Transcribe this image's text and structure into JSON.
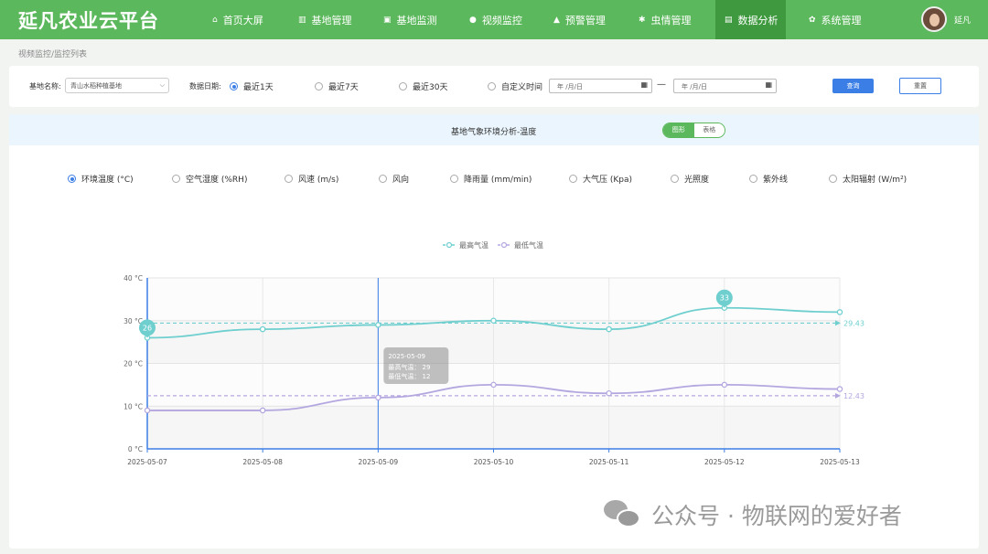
{
  "app": {
    "title": "延凡农业云平台",
    "username": "延凡"
  },
  "nav": [
    {
      "label": "首页大屏",
      "icon": "home-icon",
      "glyph": "⌂"
    },
    {
      "label": "基地管理",
      "icon": "map-icon",
      "glyph": "▥"
    },
    {
      "label": "基地监测",
      "icon": "monitor-icon",
      "glyph": "▣"
    },
    {
      "label": "视频监控",
      "icon": "location-pin-icon",
      "glyph": "●"
    },
    {
      "label": "预警管理",
      "icon": "alarm-icon",
      "glyph": "▲"
    },
    {
      "label": "虫情管理",
      "icon": "bug-icon",
      "glyph": "✱"
    },
    {
      "label": "数据分析",
      "icon": "chart-icon",
      "glyph": "▤",
      "active": true
    },
    {
      "label": "系统管理",
      "icon": "gear-icon",
      "glyph": "✿"
    }
  ],
  "breadcrumb": "视频监控/监控列表",
  "filters": {
    "base_label": "基地名称:",
    "base_value": "青山水稻种植基地",
    "date_label": "数据日期:",
    "ranges": [
      {
        "label": "最近1天",
        "selected": true
      },
      {
        "label": "最近7天",
        "selected": false
      },
      {
        "label": "最近30天",
        "selected": false
      },
      {
        "label": "自定义时间",
        "selected": false
      }
    ],
    "date_placeholder": "年 /月/日",
    "separator": "—",
    "query_button": "查询",
    "reset_button": "重置"
  },
  "panel": {
    "title": "基地气象环境分析-温度",
    "view_tabs": [
      {
        "label": "图形",
        "active": true
      },
      {
        "label": "表格",
        "active": false
      }
    ]
  },
  "metrics": [
    {
      "label": "环境温度 (°C)",
      "selected": true
    },
    {
      "label": "空气湿度 (%RH)",
      "selected": false
    },
    {
      "label": "风速 (m/s)",
      "selected": false
    },
    {
      "label": "风向",
      "selected": false
    },
    {
      "label": "降雨量 (mm/min)",
      "selected": false
    },
    {
      "label": "大气压 (Kpa)",
      "selected": false
    },
    {
      "label": "光照度",
      "selected": false
    },
    {
      "label": "紫外线",
      "selected": false
    },
    {
      "label": "太阳辐射 (W/m²)",
      "selected": false
    }
  ],
  "chart_data": {
    "type": "line",
    "categories": [
      "2025-05-07",
      "2025-05-08",
      "2025-05-09",
      "2025-05-10",
      "2025-05-11",
      "2025-05-12",
      "2025-05-13"
    ],
    "y_ticks": [
      "0 °C",
      "10 °C",
      "20 °C",
      "30 °C",
      "40 °C"
    ],
    "ylim": [
      0,
      40
    ],
    "series": [
      {
        "name": "最高气温",
        "values": [
          26,
          28,
          29,
          30,
          28,
          33,
          32
        ],
        "color": "#6fcfcf",
        "average": 29.43,
        "average_label": "29.43",
        "max_label": "33",
        "min_label": "26"
      },
      {
        "name": "最低气温",
        "values": [
          9,
          9,
          12,
          15,
          13,
          15,
          14
        ],
        "color": "#b4a7e0",
        "average": 12.43,
        "average_label": "12.43"
      }
    ],
    "tooltip": {
      "date": "2025-05-09",
      "lines": [
        "最高气温： 29",
        "最低气温： 12"
      ]
    },
    "legend": "top-center",
    "grid": true
  },
  "watermark": "公众号 · 物联网的爱好者"
}
